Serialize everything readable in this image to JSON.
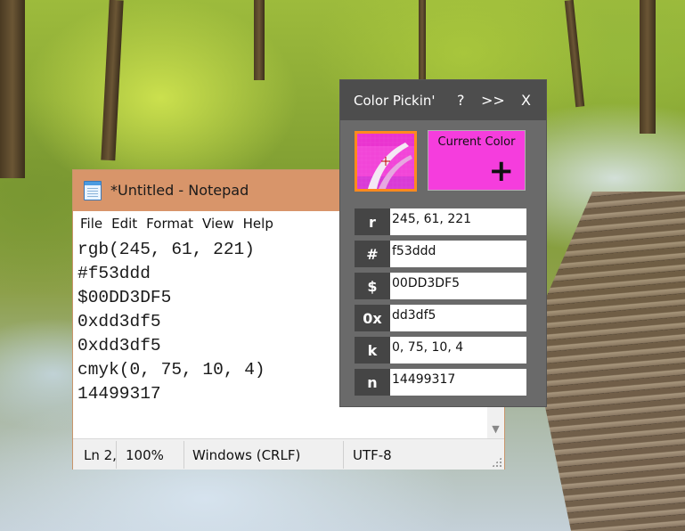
{
  "notepad": {
    "title": "*Untitled - Notepad",
    "menu": [
      "File",
      "Edit",
      "Format",
      "View",
      "Help"
    ],
    "lines": [
      "rgb(245, 61, 221)",
      "#f53ddd",
      "$00DD3DF5",
      "0xdd3df5",
      "0xdd3df5",
      "cmyk(0, 75, 10, 4)",
      "14499317"
    ],
    "status": {
      "position": "Ln 2,",
      "zoom": "100%",
      "line_ending": "Windows (CRLF)",
      "encoding": "UTF-8"
    }
  },
  "picker": {
    "title": "Color Pickin'",
    "help_label": "?",
    "expand_label": ">>",
    "close_label": "X",
    "current_color_label": "Current Color",
    "add_label": "+",
    "current_color_hex": "#f53ddd",
    "magnifier_border_color": "#ff8a1e",
    "rows": [
      {
        "key": "r",
        "value": "245, 61, 221"
      },
      {
        "key": "#",
        "value": "f53ddd"
      },
      {
        "key": "$",
        "value": "00DD3DF5"
      },
      {
        "key": "0x",
        "value": "dd3df5"
      },
      {
        "key": "k",
        "value": "0, 75, 10, 4"
      },
      {
        "key": "n",
        "value": "14499317"
      }
    ]
  }
}
